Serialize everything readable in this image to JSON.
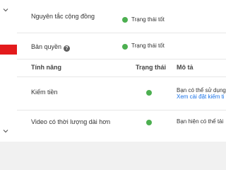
{
  "policy": {
    "community_label": "Nguyên tắc cộng đồng",
    "community_status": "Trạng thái tốt",
    "copyright_label": "Bản quyền",
    "copyright_status": "Trạng thái tốt"
  },
  "features_table": {
    "headers": {
      "feature": "Tính năng",
      "status": "Trạng thái",
      "description": "Mô tả"
    },
    "rows": [
      {
        "feature": "Kiếm tiền",
        "description": "Bạn có thể sử dụng",
        "link": "Xem cài đặt kiếm ti"
      },
      {
        "feature": "Video có thời lượng dài hơn",
        "description": "Bạn hiện có thể tải"
      }
    ]
  },
  "colors": {
    "status_good": "#4caf50",
    "accent_red": "#e31a1c",
    "link": "#1a73e8"
  },
  "icons": [
    "chevron-down-icon",
    "help-icon",
    "status-dot-icon"
  ]
}
